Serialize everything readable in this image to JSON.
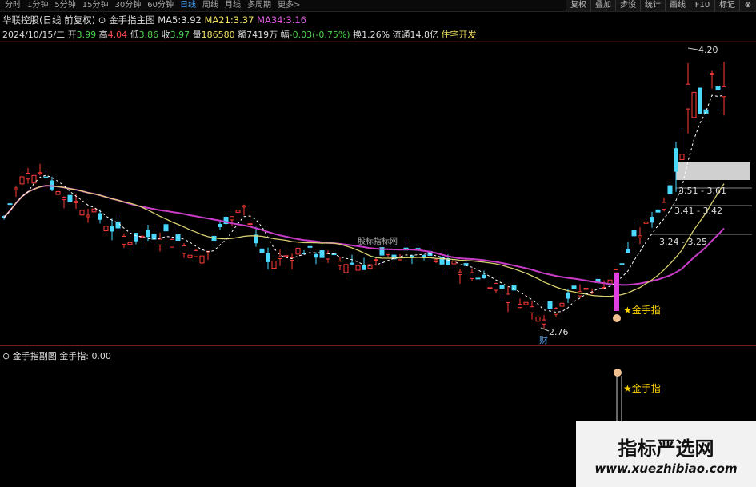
{
  "toolbar": {
    "periods": [
      "分时",
      "1分钟",
      "5分钟",
      "15分钟",
      "30分钟",
      "60分钟",
      "日线",
      "周线",
      "月线",
      "多周期",
      "更多>"
    ],
    "active_period": "日线",
    "buttons": [
      "复权",
      "叠加",
      "步设",
      "统计",
      "画线",
      "F10",
      "标记"
    ],
    "close_glyph": "⊗"
  },
  "header": {
    "stock": "华联控股(日线 前复权)",
    "indicator_title": "⊙ 金手指主图",
    "ma5_label": "MA5:",
    "ma5": "3.92",
    "ma21_label": "MA21:",
    "ma21": "3.37",
    "ma34_label": "MA34:",
    "ma34": "3.16"
  },
  "quote": {
    "date": "2024/10/15/二",
    "open_label": "开",
    "open": "3.99",
    "high_label": "高",
    "high": "4.04",
    "low_label": "低",
    "low": "3.86",
    "close_label": "收",
    "close": "3.97",
    "vol_label": "量",
    "vol": "186580",
    "amt_label": "额",
    "amt": "7419万",
    "chg_label": "幅",
    "chg": "-0.03(-0.75%)",
    "turnover": "换1.26%",
    "float": "流通14.8亿",
    "sector": "住宅开发"
  },
  "chart_labels": {
    "high_price": "4.20",
    "low_price": "2.76",
    "low_marker": "财",
    "range1": "3.51 - 3.61",
    "range2": "3.41 - 3.42",
    "range3": "3.24 - 3.25",
    "signal": "★金手指",
    "center_watermark": "股标指标网"
  },
  "sub": {
    "title": "⊙ 金手指副图",
    "value_label": "金手指:",
    "value": "0.00",
    "signal": "★金手指"
  },
  "watermark": {
    "title": "指标严选网",
    "url": "www.xuezhibiao.com"
  },
  "colors": {
    "up": "#ff3b3b",
    "down": "#4ad8ff",
    "ma5": "#ffffff",
    "ma21": "#e8e07a",
    "ma34": "#d040d0",
    "signal_bar": "#e040e0",
    "signal_text": "#ffd700"
  }
}
